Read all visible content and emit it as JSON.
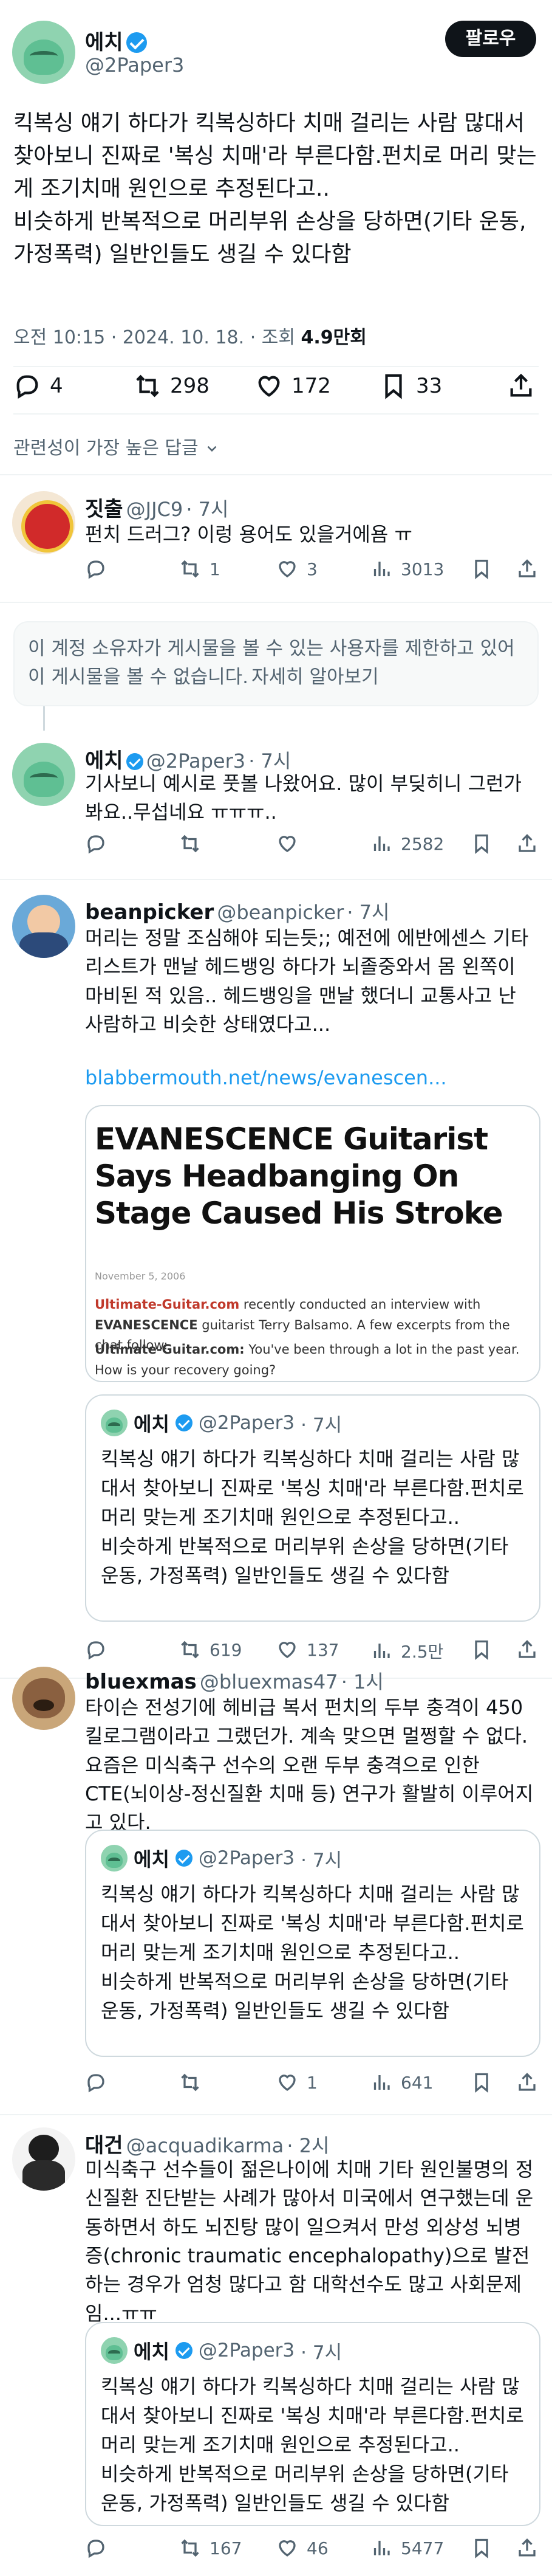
{
  "main": {
    "author": {
      "name": "에치",
      "handle": "@2Paper3"
    },
    "follow_label": "팔로우",
    "text": "킥복싱 얘기 하다가 킥복싱하다 치매 걸리는 사람 많대서 찾아보니 진짜로 '복싱 치매'라 부른다함.펀치로 머리 맞는게 조기치매 원인으로 추정된다고..\n비슷하게 반복적으로 머리부위 손상을 당하면(기타 운동, 가정폭력) 일반인들도 생길 수 있다함",
    "meta": {
      "time": "오전 10:15 · 2024. 10. 18. · 조회",
      "views": "4.9만회"
    },
    "stats": {
      "replies": "4",
      "reposts": "298",
      "likes": "172",
      "bookmarks": "33"
    },
    "sort_label": "관련성이 가장 높은 답글"
  },
  "replies": [
    {
      "name": "짓출",
      "handle": "@JJC9",
      "time": "· 7시",
      "text": "펀치 드러그? 이렁 용어도 있을거에욤 ㅠ",
      "stats": {
        "replies": "",
        "reposts": "1",
        "likes": "3",
        "views": "3013"
      }
    },
    {
      "notice": "이 계정 소유자가 게시물을 볼 수 있는 사용자를 제한하고 있어 이 게시물을 볼 수 없습니다.",
      "notice_link": "자세히 알아보기"
    },
    {
      "name": "에치",
      "handle": "@2Paper3",
      "time": "· 7시",
      "text": "기사보니 예시로 풋볼 나왔어요. 많이 부딪히니 그런가 봐요..무섭네요 ㅠㅠㅠ..",
      "stats": {
        "replies": "",
        "reposts": "",
        "likes": "",
        "views": "2582"
      }
    },
    {
      "name": "beanpicker",
      "handle": "@beanpicker",
      "time": "· 7시",
      "text": "머리는 정말 조심해야 되는듯;; 예전에 에반에센스 기타리스트가 맨날 헤드뱅잉 하다가 뇌졸중와서 몸 왼쪽이 마비된 적 있음.. 헤드뱅잉을 맨날 했더니 교통사고 난 사람하고 비슷한 상태였다고...",
      "link": "blabbermouth.net/news/evanescen...",
      "article": {
        "headline": "EVANESCENCE Guitarist Says Headbanging On Stage Caused His Stroke",
        "date": "November 5, 2006",
        "site": "Ultimate-Guitar.com",
        "p1_mid": " recently conducted an interview with ",
        "band": "EVANESCENCE",
        "p1_end": " guitarist Terry Balsamo. A few excerpts from the chat follow:",
        "q_site": "Ultimate-Guitar.com:",
        "q_text": " You've been through a lot in the past year. How is your recovery going?"
      },
      "quote": {
        "name": "에치",
        "handle": "@2Paper3",
        "time": "· 7시",
        "text": "킥복싱 얘기 하다가 킥복싱하다 치매 걸리는 사람 많대서 찾아보니 진짜로 '복싱 치매'라 부른다함.펀치로 머리 맞는게 조기치매 원인으로 추정된다고..\n비슷하게 반복적으로 머리부위 손상을 당하면(기타 운동, 가정폭력) 일반인들도 생길 수 있다함"
      },
      "stats": {
        "replies": "",
        "reposts": "619",
        "likes": "137",
        "views": "2.5만"
      }
    },
    {
      "name": "bluexmas",
      "handle": "@bluexmas47",
      "time": "· 1시",
      "text": "타이슨 전성기에 헤비급 복서 펀치의 두부 충격이 450킬로그램이라고 그랬던가. 계속 맞으면 멀쩡할 수 없다. 요즘은 미식축구 선수의 오랜 두부 충격으로 인한 CTE(뇌이상-정신질환 치매 등) 연구가 활발히 이루어지고 있다.",
      "quote": {
        "name": "에치",
        "handle": "@2Paper3",
        "time": "· 7시",
        "text": "킥복싱 얘기 하다가 킥복싱하다 치매 걸리는 사람 많대서 찾아보니 진짜로 '복싱 치매'라 부른다함.펀치로 머리 맞는게 조기치매 원인으로 추정된다고..\n비슷하게 반복적으로 머리부위 손상을 당하면(기타 운동, 가정폭력) 일반인들도 생길 수 있다함"
      },
      "stats": {
        "replies": "",
        "reposts": "",
        "likes": "1",
        "views": "641"
      }
    },
    {
      "name": "대건",
      "handle": "@acquadikarma",
      "time": "· 2시",
      "text": "미식축구 선수들이 젊은나이에 치매 기타 원인불명의 정신질환 진단받는 사례가 많아서 미국에서 연구했는데 운동하면서 하도 뇌진탕 많이 일으켜서 만성 외상성 뇌병증(chronic traumatic encephalopathy)으로 발전하는 경우가 엄청 많다고 함 대학선수도 많고 사회문제임...ㅠㅠ",
      "quote": {
        "name": "에치",
        "handle": "@2Paper3",
        "time": "· 7시",
        "text": "킥복싱 얘기 하다가 킥복싱하다 치매 걸리는 사람 많대서 찾아보니 진짜로 '복싱 치매'라 부른다함.펀치로 머리 맞는게 조기치매 원인으로 추정된다고..\n비슷하게 반복적으로 머리부위 손상을 당하면(기타 운동, 가정폭력) 일반인들도 생길 수 있다함"
      },
      "stats": {
        "replies": "",
        "reposts": "167",
        "likes": "46",
        "views": "5477"
      }
    }
  ],
  "icons": [
    "reply-icon",
    "repost-icon",
    "like-icon",
    "bookmark-icon",
    "share-icon",
    "views-icon",
    "verified-icon",
    "chevron-down-icon"
  ],
  "colors": {
    "accent": "#1d9bf0",
    "text": "#0f1419",
    "muted": "#536471",
    "border": "#cfd9de"
  }
}
